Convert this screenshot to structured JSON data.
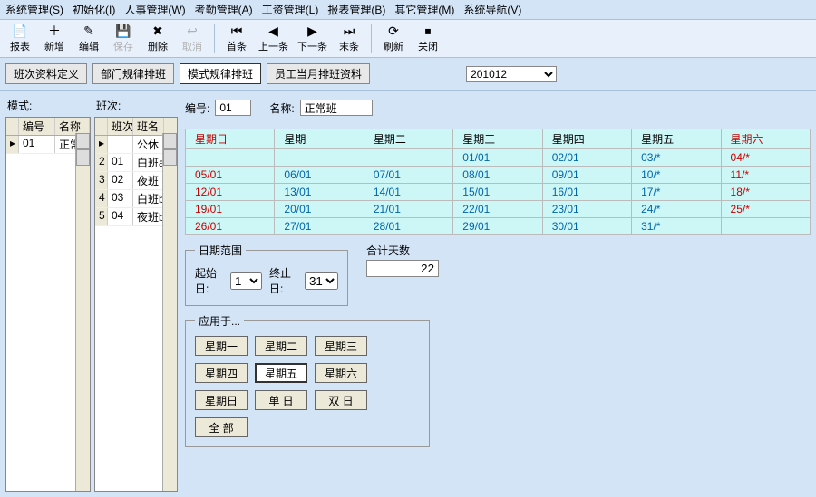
{
  "menu": [
    "系统管理(S)",
    "初始化(I)",
    "人事管理(W)",
    "考勤管理(A)",
    "工资管理(L)",
    "报表管理(B)",
    "其它管理(M)",
    "系统导航(V)"
  ],
  "toolbar": [
    {
      "name": "report",
      "label": "报表",
      "icon": "📄",
      "enabled": true
    },
    {
      "name": "add",
      "label": "新增",
      "icon": "＋",
      "enabled": true
    },
    {
      "name": "edit",
      "label": "编辑",
      "icon": "✎",
      "enabled": true
    },
    {
      "name": "save",
      "label": "保存",
      "icon": "💾",
      "enabled": false
    },
    {
      "name": "delete",
      "label": "删除",
      "icon": "✖",
      "enabled": true
    },
    {
      "name": "cancel",
      "label": "取消",
      "icon": "↩",
      "enabled": false
    },
    {
      "sep": true
    },
    {
      "name": "first",
      "label": "首条",
      "icon": "⏮",
      "enabled": true
    },
    {
      "name": "prev",
      "label": "上一条",
      "icon": "◀",
      "enabled": true
    },
    {
      "name": "next",
      "label": "下一条",
      "icon": "▶",
      "enabled": true
    },
    {
      "name": "last",
      "label": "末条",
      "icon": "⏭",
      "enabled": true
    },
    {
      "sep": true
    },
    {
      "name": "refresh",
      "label": "刷新",
      "icon": "⟳",
      "enabled": true
    },
    {
      "name": "close",
      "label": "关闭",
      "icon": "⏹",
      "enabled": true
    }
  ],
  "tabs": [
    {
      "label": "班次资料定义",
      "active": false
    },
    {
      "label": "部门规律排班",
      "active": false
    },
    {
      "label": "模式规律排班",
      "active": true
    },
    {
      "label": "员工当月排班资料",
      "active": false
    }
  ],
  "period": "201012",
  "modes": {
    "title": "模式:",
    "headers": [
      "编号",
      "名称"
    ],
    "rows": [
      {
        "no": "01",
        "name": "正常班"
      }
    ]
  },
  "shifts": {
    "title": "班次:",
    "headers": [
      "班次",
      "班名"
    ],
    "rows": [
      {
        "no": "",
        "name": "公休"
      },
      {
        "no": "01",
        "name": "白班a"
      },
      {
        "no": "02",
        "name": "夜班"
      },
      {
        "no": "03",
        "name": "白班b"
      },
      {
        "no": "04",
        "name": "夜班b"
      }
    ]
  },
  "form": {
    "no_label": "编号:",
    "no": "01",
    "name_label": "名称:",
    "name": "正常班"
  },
  "cal": {
    "headers": [
      "星期日",
      "星期一",
      "星期二",
      "星期三",
      "星期四",
      "星期五",
      "星期六"
    ],
    "rows": [
      [
        "",
        "",
        "",
        "01/01",
        "02/01",
        "03/*",
        "04/*"
      ],
      [
        "05/01",
        "06/01",
        "07/01",
        "08/01",
        "09/01",
        "10/*",
        "11/*"
      ],
      [
        "12/01",
        "13/01",
        "14/01",
        "15/01",
        "16/01",
        "17/*",
        "18/*"
      ],
      [
        "19/01",
        "20/01",
        "21/01",
        "22/01",
        "23/01",
        "24/*",
        "25/*"
      ],
      [
        "26/01",
        "27/01",
        "28/01",
        "29/01",
        "30/01",
        "31/*",
        ""
      ]
    ]
  },
  "range": {
    "legend": "日期范围",
    "start_label": "起始日:",
    "start": "1",
    "end_label": "终止日:",
    "end": "31",
    "total_label": "合计天数",
    "total": "22"
  },
  "apply": {
    "legend": "应用于...",
    "buttons": [
      "星期一",
      "星期二",
      "星期三",
      "星期四",
      "星期五",
      "星期六",
      "星期日",
      "单 日",
      "双 日",
      "全 部"
    ],
    "selected": "星期五"
  }
}
